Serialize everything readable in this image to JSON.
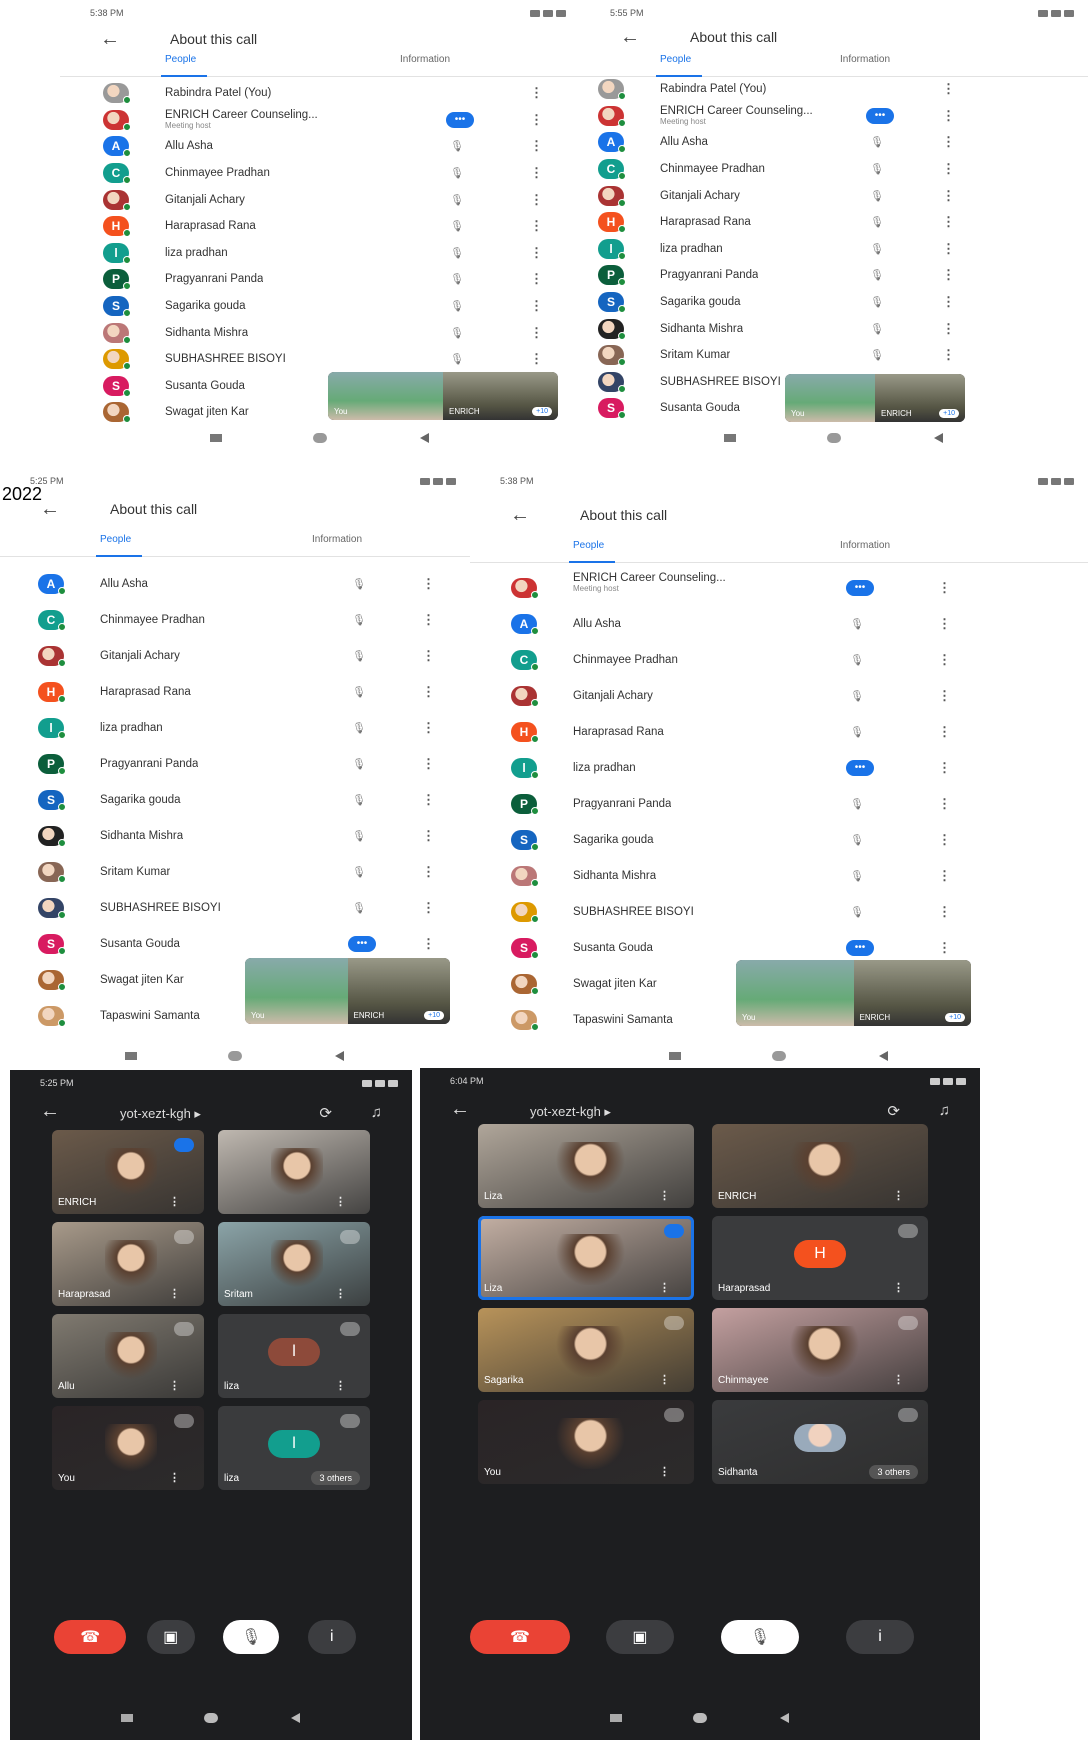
{
  "year_label": "2022",
  "screens": [
    {
      "id": "s1",
      "time": "5:38 PM",
      "title": "About this call",
      "tabs": [
        "People",
        "Information"
      ],
      "participants": [
        {
          "name": "Rabindra Patel (You)",
          "color": "#999",
          "photo": true,
          "status": "none"
        },
        {
          "name": "ENRICH Career Counseling...",
          "sub": "Meeting host",
          "color": "#c33",
          "photo": true,
          "status": "speaking"
        },
        {
          "name": "Allu Asha",
          "letter": "A",
          "color": "#1a73e8",
          "status": "muted"
        },
        {
          "name": "Chinmayee Pradhan",
          "letter": "C",
          "color": "#129e8e",
          "status": "muted"
        },
        {
          "name": "Gitanjali Achary",
          "color": "#a33",
          "photo": true,
          "status": "muted"
        },
        {
          "name": "Haraprasad Rana",
          "letter": "H",
          "color": "#f4511e",
          "status": "muted"
        },
        {
          "name": "liza pradhan",
          "letter": "l",
          "color": "#129e8e",
          "status": "muted"
        },
        {
          "name": "Pragyanrani Panda",
          "letter": "P",
          "color": "#0b5e3b",
          "status": "muted"
        },
        {
          "name": "Sagarika gouda",
          "letter": "S",
          "color": "#1565c0",
          "status": "muted"
        },
        {
          "name": "Sidhanta Mishra",
          "color": "#b77",
          "photo": true,
          "status": "muted"
        },
        {
          "name": "SUBHASHREE BISOYI",
          "color": "#d90",
          "photo": true,
          "status": "muted"
        },
        {
          "name": "Susanta Gouda",
          "letter": "S",
          "color": "#d81b60",
          "status": "muted"
        },
        {
          "name": "Swagat jiten Kar",
          "color": "#a63",
          "photo": true,
          "status": "muted"
        }
      ],
      "pip": {
        "you": "You",
        "host": "ENRICH",
        "badge": "+10"
      }
    },
    {
      "id": "s2",
      "time": "5:55 PM",
      "title": "About this call",
      "tabs": [
        "People",
        "Information"
      ],
      "participants": [
        {
          "name": "Rabindra Patel (You)",
          "color": "#999",
          "photo": true,
          "status": "none"
        },
        {
          "name": "ENRICH Career Counseling...",
          "sub": "Meeting host",
          "color": "#c33",
          "photo": true,
          "status": "speaking"
        },
        {
          "name": "Allu Asha",
          "letter": "A",
          "color": "#1a73e8",
          "status": "muted"
        },
        {
          "name": "Chinmayee Pradhan",
          "letter": "C",
          "color": "#129e8e",
          "status": "muted"
        },
        {
          "name": "Gitanjali Achary",
          "color": "#a33",
          "photo": true,
          "status": "muted"
        },
        {
          "name": "Haraprasad Rana",
          "letter": "H",
          "color": "#f4511e",
          "status": "muted"
        },
        {
          "name": "liza pradhan",
          "letter": "l",
          "color": "#129e8e",
          "status": "muted"
        },
        {
          "name": "Pragyanrani Panda",
          "letter": "P",
          "color": "#0b5e3b",
          "status": "muted"
        },
        {
          "name": "Sagarika gouda",
          "letter": "S",
          "color": "#1565c0",
          "status": "muted"
        },
        {
          "name": "Sidhanta Mishra",
          "color": "#222",
          "photo": true,
          "status": "muted"
        },
        {
          "name": "Sritam Kumar",
          "color": "#865",
          "photo": true,
          "status": "muted"
        },
        {
          "name": "SUBHASHREE BISOYI",
          "color": "#346",
          "photo": true,
          "status": "muted"
        },
        {
          "name": "Susanta Gouda",
          "letter": "S",
          "color": "#d81b60",
          "status": "muted"
        }
      ],
      "pip": {
        "you": "You",
        "host": "ENRICH",
        "badge": "+10"
      }
    },
    {
      "id": "s3",
      "time": "5:25 PM",
      "title": "About this call",
      "tabs": [
        "People",
        "Information"
      ],
      "participants": [
        {
          "name": "Allu Asha",
          "letter": "A",
          "color": "#1a73e8",
          "status": "muted"
        },
        {
          "name": "Chinmayee Pradhan",
          "letter": "C",
          "color": "#129e8e",
          "status": "muted"
        },
        {
          "name": "Gitanjali Achary",
          "color": "#a33",
          "photo": true,
          "status": "muted"
        },
        {
          "name": "Haraprasad Rana",
          "letter": "H",
          "color": "#f4511e",
          "status": "muted"
        },
        {
          "name": "liza pradhan",
          "letter": "l",
          "color": "#129e8e",
          "status": "muted"
        },
        {
          "name": "Pragyanrani Panda",
          "letter": "P",
          "color": "#0b5e3b",
          "status": "muted"
        },
        {
          "name": "Sagarika gouda",
          "letter": "S",
          "color": "#1565c0",
          "status": "muted"
        },
        {
          "name": "Sidhanta Mishra",
          "color": "#222",
          "photo": true,
          "status": "muted"
        },
        {
          "name": "Sritam Kumar",
          "color": "#865",
          "photo": true,
          "status": "muted"
        },
        {
          "name": "SUBHASHREE BISOYI",
          "color": "#346",
          "photo": true,
          "status": "muted"
        },
        {
          "name": "Susanta Gouda",
          "letter": "S",
          "color": "#d81b60",
          "status": "speaking"
        },
        {
          "name": "Swagat jiten Kar",
          "color": "#a63",
          "photo": true,
          "status": "none"
        },
        {
          "name": "Tapaswini Samanta",
          "color": "#c96",
          "photo": true,
          "status": "none"
        }
      ],
      "pip": {
        "you": "You",
        "host": "ENRICH",
        "badge": "+10"
      }
    },
    {
      "id": "s4",
      "time": "5:38 PM",
      "title": "About this call",
      "tabs": [
        "People",
        "Information"
      ],
      "participants": [
        {
          "name": "ENRICH Career Counseling...",
          "sub": "Meeting host",
          "color": "#c33",
          "photo": true,
          "status": "speaking"
        },
        {
          "name": "Allu Asha",
          "letter": "A",
          "color": "#1a73e8",
          "status": "muted"
        },
        {
          "name": "Chinmayee Pradhan",
          "letter": "C",
          "color": "#129e8e",
          "status": "muted"
        },
        {
          "name": "Gitanjali Achary",
          "color": "#a33",
          "photo": true,
          "status": "muted"
        },
        {
          "name": "Haraprasad Rana",
          "letter": "H",
          "color": "#f4511e",
          "status": "muted"
        },
        {
          "name": "liza pradhan",
          "letter": "l",
          "color": "#129e8e",
          "status": "speaking"
        },
        {
          "name": "Pragyanrani Panda",
          "letter": "P",
          "color": "#0b5e3b",
          "status": "muted"
        },
        {
          "name": "Sagarika gouda",
          "letter": "S",
          "color": "#1565c0",
          "status": "muted"
        },
        {
          "name": "Sidhanta Mishra",
          "color": "#b77",
          "photo": true,
          "status": "muted"
        },
        {
          "name": "SUBHASHREE BISOYI",
          "color": "#d90",
          "photo": true,
          "status": "muted"
        },
        {
          "name": "Susanta Gouda",
          "letter": "S",
          "color": "#d81b60",
          "status": "speaking"
        },
        {
          "name": "Swagat jiten Kar",
          "color": "#a63",
          "photo": true,
          "status": "none"
        },
        {
          "name": "Tapaswini Samanta",
          "color": "#c96",
          "photo": true,
          "status": "none"
        }
      ],
      "pip": {
        "you": "You",
        "host": "ENRICH",
        "badge": "+10"
      }
    }
  ],
  "calls": [
    {
      "id": "c1",
      "time": "5:25 PM",
      "code": "yot-xezt-kgh",
      "tiles": [
        {
          "name": "ENRICH",
          "bg": "#6b5a4a",
          "mic": "blue"
        },
        {
          "name": "",
          "bg": "#bfb8b0",
          "mic": ""
        },
        {
          "name": "Haraprasad",
          "bg": "#a89a8a",
          "mic": "grey"
        },
        {
          "name": "Sritam",
          "bg": "#8ba4a8",
          "mic": "grey"
        },
        {
          "name": "Allu",
          "bg": "#807a70",
          "mic": "grey"
        },
        {
          "name": "liza",
          "bg": "#3a3b3d",
          "avatar": "l",
          "avatarColor": "#8d4a3a",
          "mic": "grey"
        },
        {
          "name": "You",
          "bg": "#2a2426",
          "mic": "grey"
        },
        {
          "name": "liza",
          "bg": "#3a3b3d",
          "avatar": "l",
          "avatarColor": "#129e8e",
          "mic": "grey",
          "others": "3 others"
        }
      ]
    },
    {
      "id": "c2",
      "time": "6:04 PM",
      "code": "yot-xezt-kgh",
      "tiles": [
        {
          "name": "Liza",
          "bg": "#b0a69a",
          "mic": ""
        },
        {
          "name": "ENRICH",
          "bg": "#6b5a4a",
          "mic": ""
        },
        {
          "name": "Liza",
          "bg": "#c4b0a4",
          "mic": "blue",
          "hl": true
        },
        {
          "name": "Haraprasad",
          "bg": "#3a3b3d",
          "avatar": "H",
          "avatarColor": "#f4511e",
          "mic": "grey"
        },
        {
          "name": "Sagarika",
          "bg": "#b8935a",
          "mic": "grey"
        },
        {
          "name": "Chinmayee",
          "bg": "#c4a0a0",
          "mic": "grey"
        },
        {
          "name": "You",
          "bg": "#2a2426",
          "mic": "grey"
        },
        {
          "name": "Sidhanta",
          "bg": "#3a3b3d",
          "mic": "grey",
          "others": "3 others"
        }
      ]
    }
  ]
}
